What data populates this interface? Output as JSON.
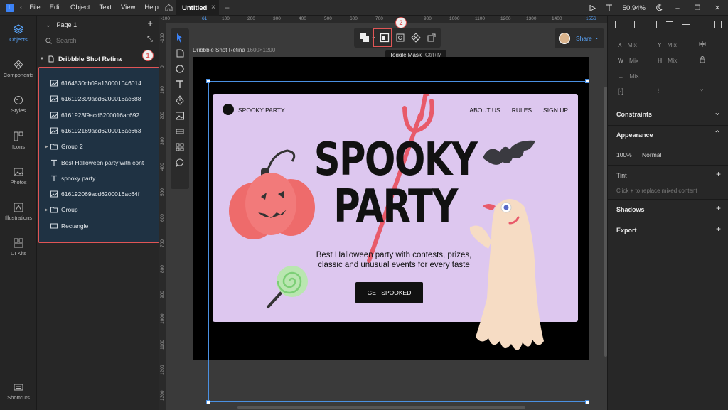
{
  "topbar": {
    "menu": [
      "File",
      "Edit",
      "Object",
      "Text",
      "View",
      "Help"
    ],
    "tab_title": "Untitled",
    "tab_close": "×",
    "tab_add": "+",
    "zoom": "50.94%"
  },
  "rail": {
    "items": [
      "Objects",
      "Components",
      "Styles",
      "Icons",
      "Photos",
      "Illustrations",
      "UI Kits"
    ],
    "shortcuts": "Shortcuts"
  },
  "layers": {
    "page": "Page 1",
    "search_placeholder": "Search",
    "artboard": "Dribbble Shot Retina",
    "items": [
      {
        "label": "6164530cb09a130001046014",
        "type": "image"
      },
      {
        "label": "616192399acd6200016ac688",
        "type": "image"
      },
      {
        "label": "6161923f9acd6200016ac692",
        "type": "image"
      },
      {
        "label": "616192169acd6200016ac663",
        "type": "image"
      },
      {
        "label": "Group 2",
        "type": "group"
      },
      {
        "label": "Best Halloween party with cont",
        "type": "text"
      },
      {
        "label": "spooky party",
        "type": "text"
      },
      {
        "label": "616192069acd6200016ac64f",
        "type": "image"
      },
      {
        "label": "Group",
        "type": "group"
      },
      {
        "label": "Rectangle",
        "type": "rect"
      }
    ],
    "badge": "1"
  },
  "canvas": {
    "ruler_top": [
      "-100",
      "61",
      "100",
      "200",
      "300",
      "400",
      "500",
      "600",
      "700",
      "900",
      "1000",
      "1100",
      "1200",
      "1300",
      "1400",
      "1556"
    ],
    "ruler_left": [
      "-100",
      "0",
      "100",
      "200",
      "300",
      "400",
      "500",
      "600",
      "700",
      "800",
      "900",
      "1000",
      "1100",
      "1200",
      "1300"
    ],
    "artboard_name": "Dribbble Shot Retina",
    "artboard_size": "1600×1200",
    "tooltip": "Toggle Mask",
    "tooltip_shortcut": "Ctrl+M",
    "badge": "2",
    "share": "Share"
  },
  "site": {
    "brand": "SPOOKY PARTY",
    "nav": [
      "ABOUT US",
      "RULES",
      "SIGN UP"
    ],
    "headline_1": "SPOOKY",
    "headline_2": "PARTY",
    "subline_1": "Best Halloween party with contests, prizes,",
    "subline_2": "classic and unusual events for every taste",
    "cta": "GET SPOOKED"
  },
  "props": {
    "x": "Mix",
    "y": "Mix",
    "w": "Mix",
    "h": "Mix",
    "r": "Mix",
    "constraints": "Constraints",
    "appearance": "Appearance",
    "opacity": "100%",
    "blend": "Normal",
    "tint": "Tint",
    "tint_hint": "Click + to replace mixed content",
    "shadows": "Shadows",
    "export": "Export"
  },
  "colors": {
    "accent": "#5aa7ff",
    "highlight": "#e05555",
    "site_bg": "#ddc7ef"
  }
}
